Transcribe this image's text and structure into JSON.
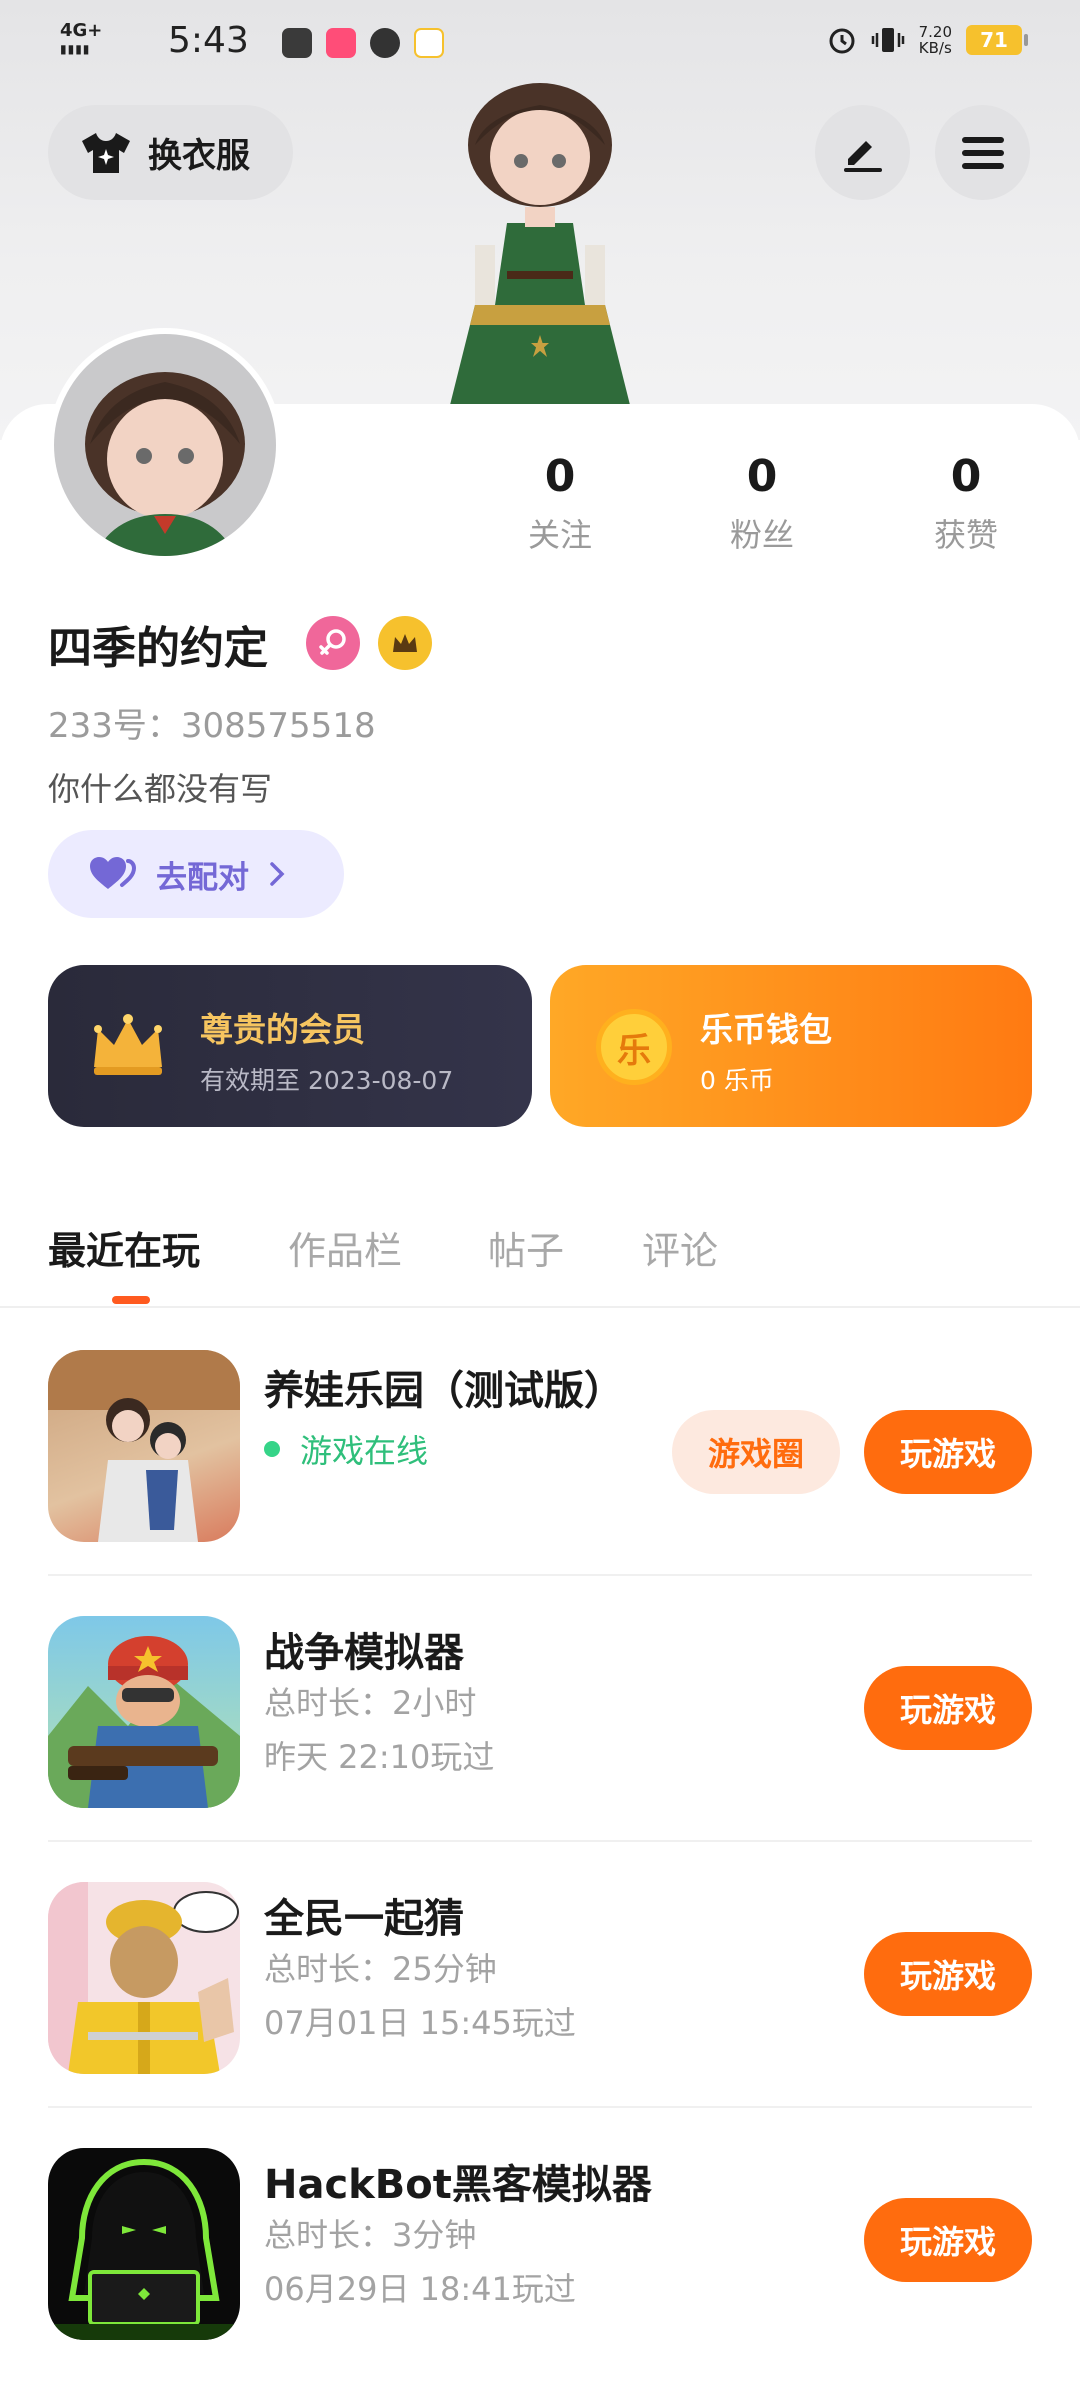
{
  "status_bar": {
    "signal": "4G+",
    "time": "5:43",
    "net_speed_value": "7.20",
    "net_speed_unit": "KB/s",
    "battery": "71"
  },
  "header": {
    "dress_up_label": "换衣服",
    "edit_icon": "pencil-icon",
    "menu_icon": "hamburger-menu-icon"
  },
  "profile": {
    "stats": [
      {
        "value": "0",
        "label": "关注"
      },
      {
        "value": "0",
        "label": "粉丝"
      },
      {
        "value": "0",
        "label": "获赞"
      }
    ],
    "username": "四季的约定",
    "uid": "233号：308575518",
    "bio": "你什么都没有写",
    "match_label": "去配对"
  },
  "member_card": {
    "title": "尊贵的会员",
    "subtitle": "有效期至 2023-08-07"
  },
  "wallet_card": {
    "title": "乐币钱包",
    "subtitle": "0 乐币",
    "coin_glyph": "乐"
  },
  "tabs": [
    {
      "label": "最近在玩",
      "active": true
    },
    {
      "label": "作品栏",
      "active": false
    },
    {
      "label": "帖子",
      "active": false
    },
    {
      "label": "评论",
      "active": false
    }
  ],
  "games": [
    {
      "name": "养娃乐园（测试版）",
      "status": "游戏在线",
      "circle_label": "游戏圈",
      "play_label": "玩游戏"
    },
    {
      "name": "战争模拟器",
      "duration": "总时长：2小时",
      "last_played": "昨天 22:10玩过",
      "play_label": "玩游戏"
    },
    {
      "name": "全民一起猜",
      "duration": "总时长：25分钟",
      "last_played": "07月01日 15:45玩过",
      "play_label": "玩游戏"
    },
    {
      "name": "HackBot黑客模拟器",
      "duration": "总时长：3分钟",
      "last_played": "06月29日 18:41玩过",
      "play_label": "玩游戏"
    }
  ],
  "colors": {
    "accent": "#ff6c0e",
    "online": "#35d488",
    "match": "#7468d6",
    "gold": "#f6c12d"
  }
}
